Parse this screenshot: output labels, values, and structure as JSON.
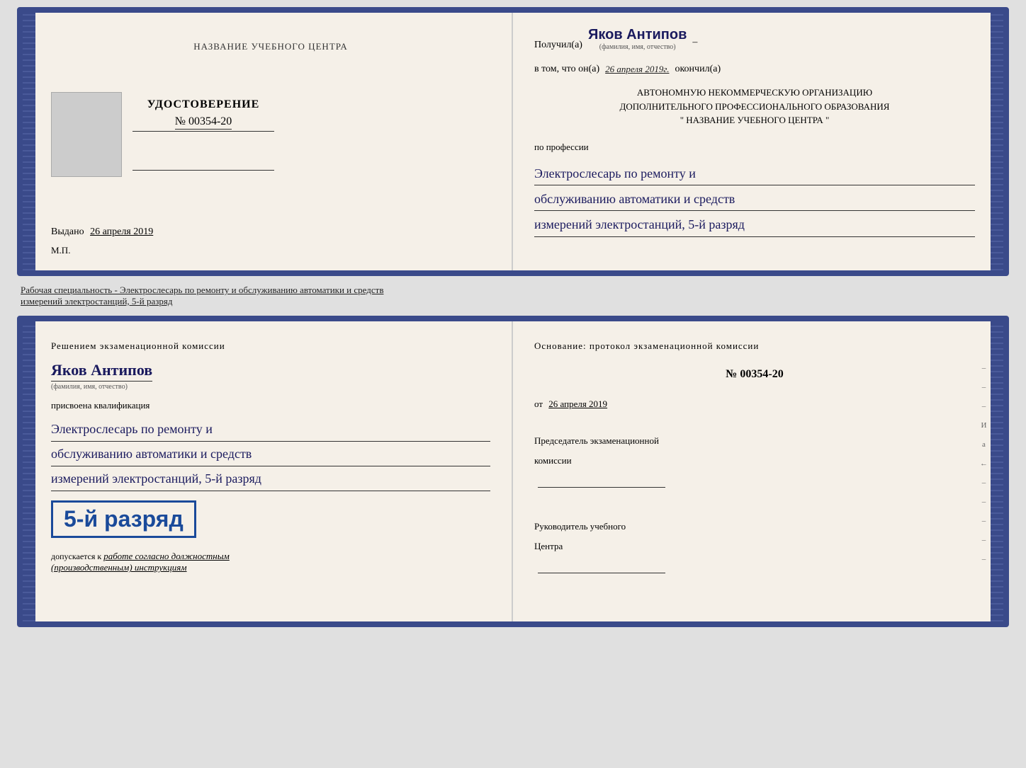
{
  "top_book": {
    "left": {
      "org_name": "НАЗВАНИЕ УЧЕБНОГО ЦЕНТРА",
      "cert_title": "УДОСТОВЕРЕНИЕ",
      "cert_number": "№ 00354-20",
      "issued_label": "Выдано",
      "issued_date": "26 апреля 2019",
      "stamp_label": "М.П."
    },
    "right": {
      "received_label": "Получил(а)",
      "recipient_name": "Яков Антипов",
      "name_subtext": "(фамилия, имя, отчество)",
      "confirms_prefix": "в том, что он(а)",
      "confirms_date": "26 апреля 2019г.",
      "confirms_suffix": "окончил(а)",
      "org_line1": "АВТОНОМНУЮ НЕКОММЕРЧЕСКУЮ ОРГАНИЗАЦИЮ",
      "org_line2": "ДОПОЛНИТЕЛЬНОГО ПРОФЕССИОНАЛЬНОГО ОБРАЗОВАНИЯ",
      "org_line3": "\"  НАЗВАНИЕ УЧЕБНОГО ЦЕНТРА  \"",
      "profession_label": "по профессии",
      "profession_line1": "Электрослесарь по ремонту и",
      "profession_line2": "обслуживанию автоматики и средств",
      "profession_line3": "измерений электростанций, 5-й разряд"
    }
  },
  "middle": {
    "text1": "Рабочая специальность - Электрослесарь по ремонту и обслуживанию автоматики и средств",
    "text2": "измерений электростанций, 5-й разряд"
  },
  "bottom_book": {
    "left": {
      "decision_text": "Решением  экзаменационной  комиссии",
      "person_name": "Яков Антипов",
      "name_subtext": "(фамилия, имя, отчество)",
      "assigned_text": "присвоена квалификация",
      "qual_line1": "Электрослесарь по ремонту и",
      "qual_line2": "обслуживанию автоматики и средств",
      "qual_line3": "измерений электростанций, 5-й разряд",
      "rank_badge": "5-й разряд",
      "admitted_prefix": "допускается к",
      "admitted_text": "работе согласно должностным",
      "admitted_italic": "(производственным) инструкциям"
    },
    "right": {
      "basis_text": "Основание:  протокол  экзаменационной  комиссии",
      "protocol_number": "№  00354-20",
      "date_from_prefix": "от",
      "date_from": "26 апреля 2019",
      "chairman_label": "Председатель экзаменационной",
      "chairman_label2": "комиссии",
      "director_label": "Руководитель учебного",
      "director_label2": "Центра"
    }
  },
  "side_markers": [
    "И",
    "а",
    "←",
    "–",
    "–",
    "–",
    "–"
  ]
}
